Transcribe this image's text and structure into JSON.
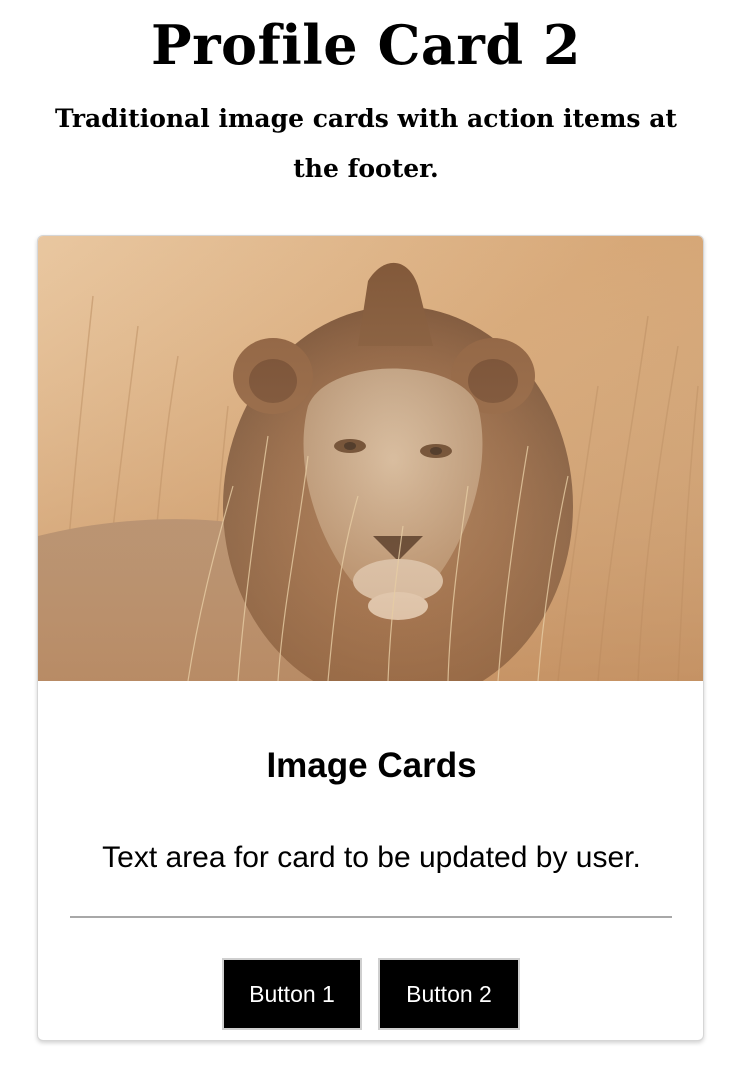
{
  "header": {
    "title": "Profile Card 2",
    "subtitle": "Traditional image cards with action items at the footer."
  },
  "card": {
    "image_alt": "lion-photo",
    "heading": "Image Cards",
    "text": "Text area for card to be updated by user.",
    "buttons": [
      {
        "label": "Button 1"
      },
      {
        "label": "Button 2"
      }
    ]
  },
  "colors": {
    "button_bg": "#000000",
    "button_text": "#ffffff",
    "divider": "#a8a8a8"
  }
}
